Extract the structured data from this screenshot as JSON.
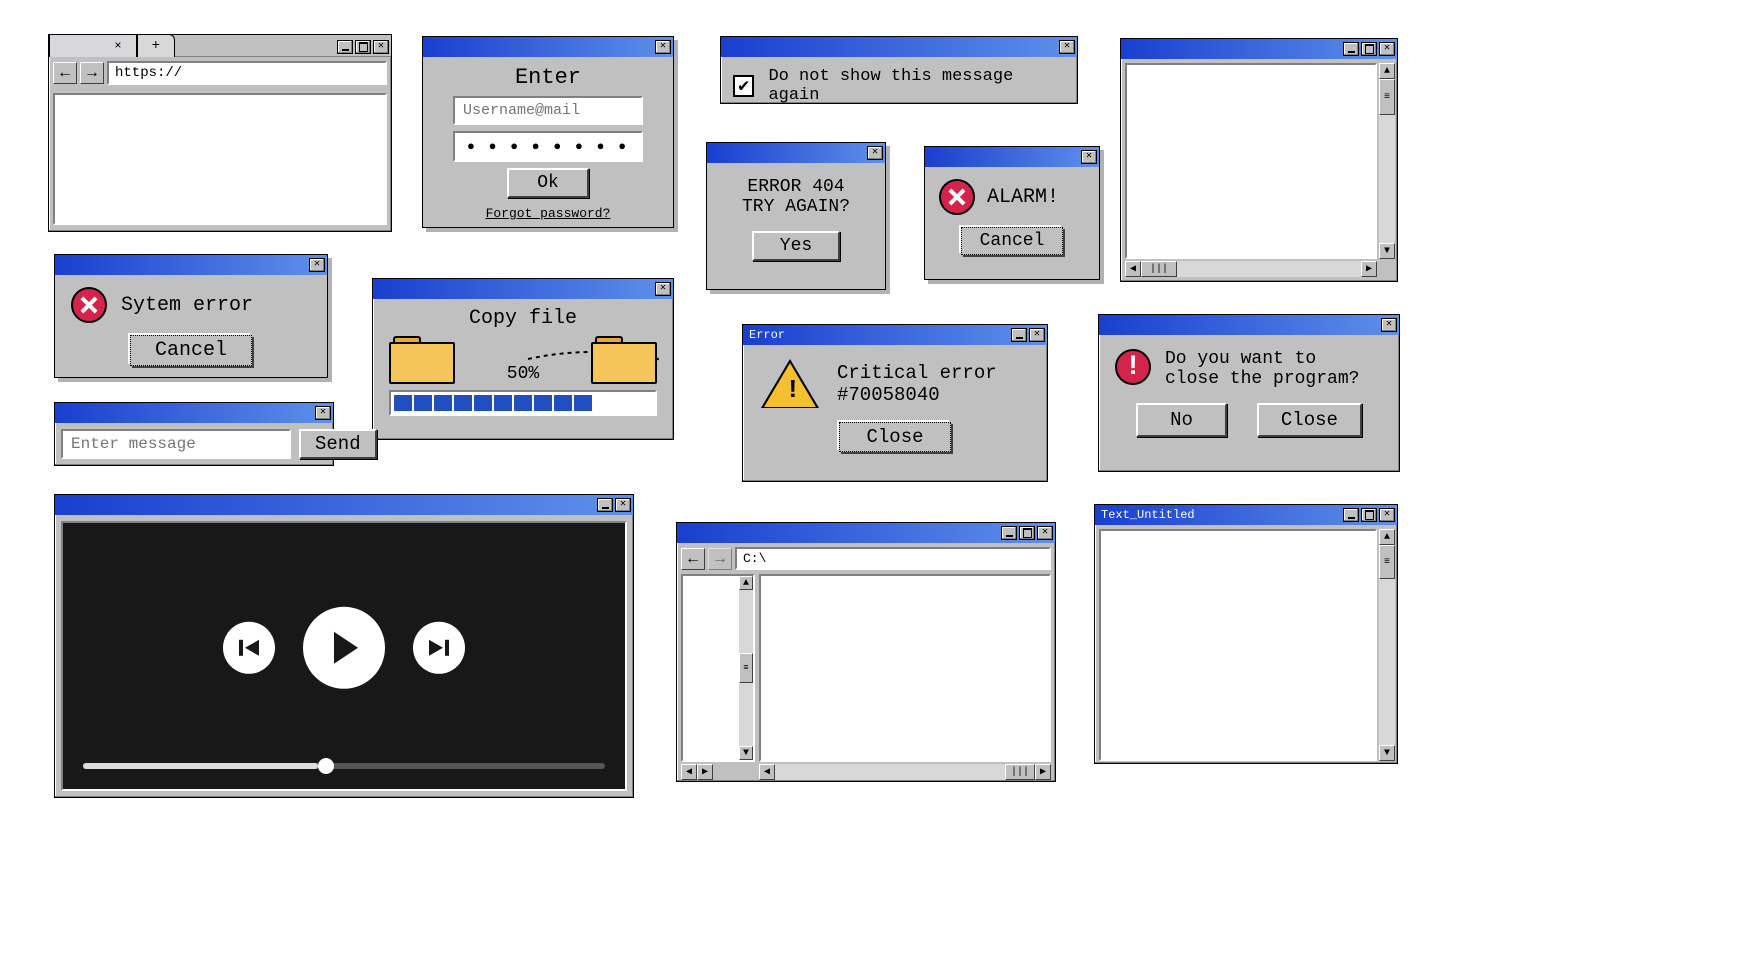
{
  "browser": {
    "url": "https://",
    "tab_close": "×",
    "tab_plus": "+"
  },
  "login": {
    "title": "Enter",
    "user_placeholder": "Username@mail",
    "password_dots": "● ● ● ● ● ● ● ●",
    "ok": "Ok",
    "forgot": "Forgot password?"
  },
  "dontshow": {
    "text": "Do not show this message again",
    "checked": "✔"
  },
  "panel1": {},
  "syserror": {
    "text": "Sytem error",
    "cancel": "Cancel"
  },
  "err404": {
    "line1": "ERROR 404",
    "line2": "TRY AGAIN?",
    "yes": "Yes"
  },
  "alarm": {
    "text": "ALARM!",
    "cancel": "Cancel"
  },
  "copy": {
    "title": "Copy file",
    "percent": "50%"
  },
  "critical": {
    "titlebar": "Error",
    "line1": "Critical error",
    "line2": "#70058040",
    "close": "Close"
  },
  "closeprog": {
    "line1": "Do you want to",
    "line2": "close the program?",
    "no": "No",
    "close": "Close"
  },
  "send": {
    "placeholder": "Enter message",
    "btn": "Send"
  },
  "explorer": {
    "path": "C:\\"
  },
  "textedit": {
    "title": "Text_Untitled"
  }
}
